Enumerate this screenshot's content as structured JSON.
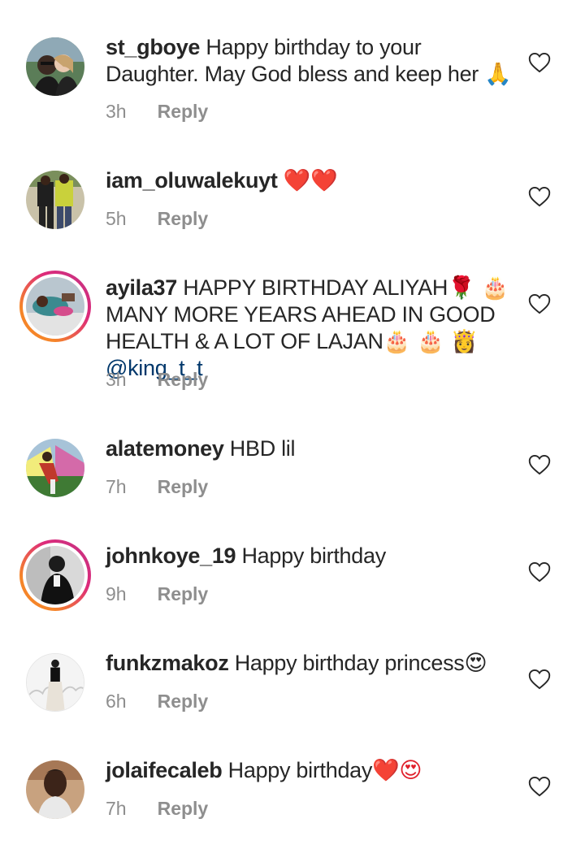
{
  "comments": [
    {
      "username": "st_gboye",
      "text": "Happy birthday to your Daughter. May God bless and keep her",
      "emoji": "🙏",
      "time": "3h",
      "reply": "Reply"
    },
    {
      "username": "iam_oluwalekuyt",
      "text": "",
      "emoji": "❤️❤️",
      "time": "5h",
      "reply": "Reply"
    },
    {
      "username": "ayila37",
      "text_part1": "HAPPY BIRTHDAY ALIYAH",
      "emoji_part1": "🌹 🎂",
      "text_part2": "MANY MORE YEARS AHEAD IN GOOD HEALTH & A LOT OF LAJAN",
      "emoji_part2": "🎂 🎂 👸",
      "mention": "@king_t_t",
      "time": "3h",
      "reply": "Reply"
    },
    {
      "username": "alatemoney",
      "text": "HBD lil",
      "time": "7h",
      "reply": "Reply"
    },
    {
      "username": "johnkoye_19",
      "text": "Happy birthday",
      "time": "9h",
      "reply": "Reply"
    },
    {
      "username": "funkzmakoz",
      "text": "Happy birthday princess",
      "emoji": "😍",
      "time": "6h",
      "reply": "Reply"
    },
    {
      "username": "jolaifecaleb",
      "text": "Happy birthday",
      "emoji": "❤️😍",
      "time": "7h",
      "reply": "Reply"
    }
  ],
  "icons": {
    "like": "heart-outline-icon"
  },
  "colors": {
    "text": "#262626",
    "meta": "#8e8e8e",
    "mention": "#00376b",
    "story_ring_start": "#f58529",
    "story_ring_end": "#c13584",
    "heart": "#e0202b"
  }
}
